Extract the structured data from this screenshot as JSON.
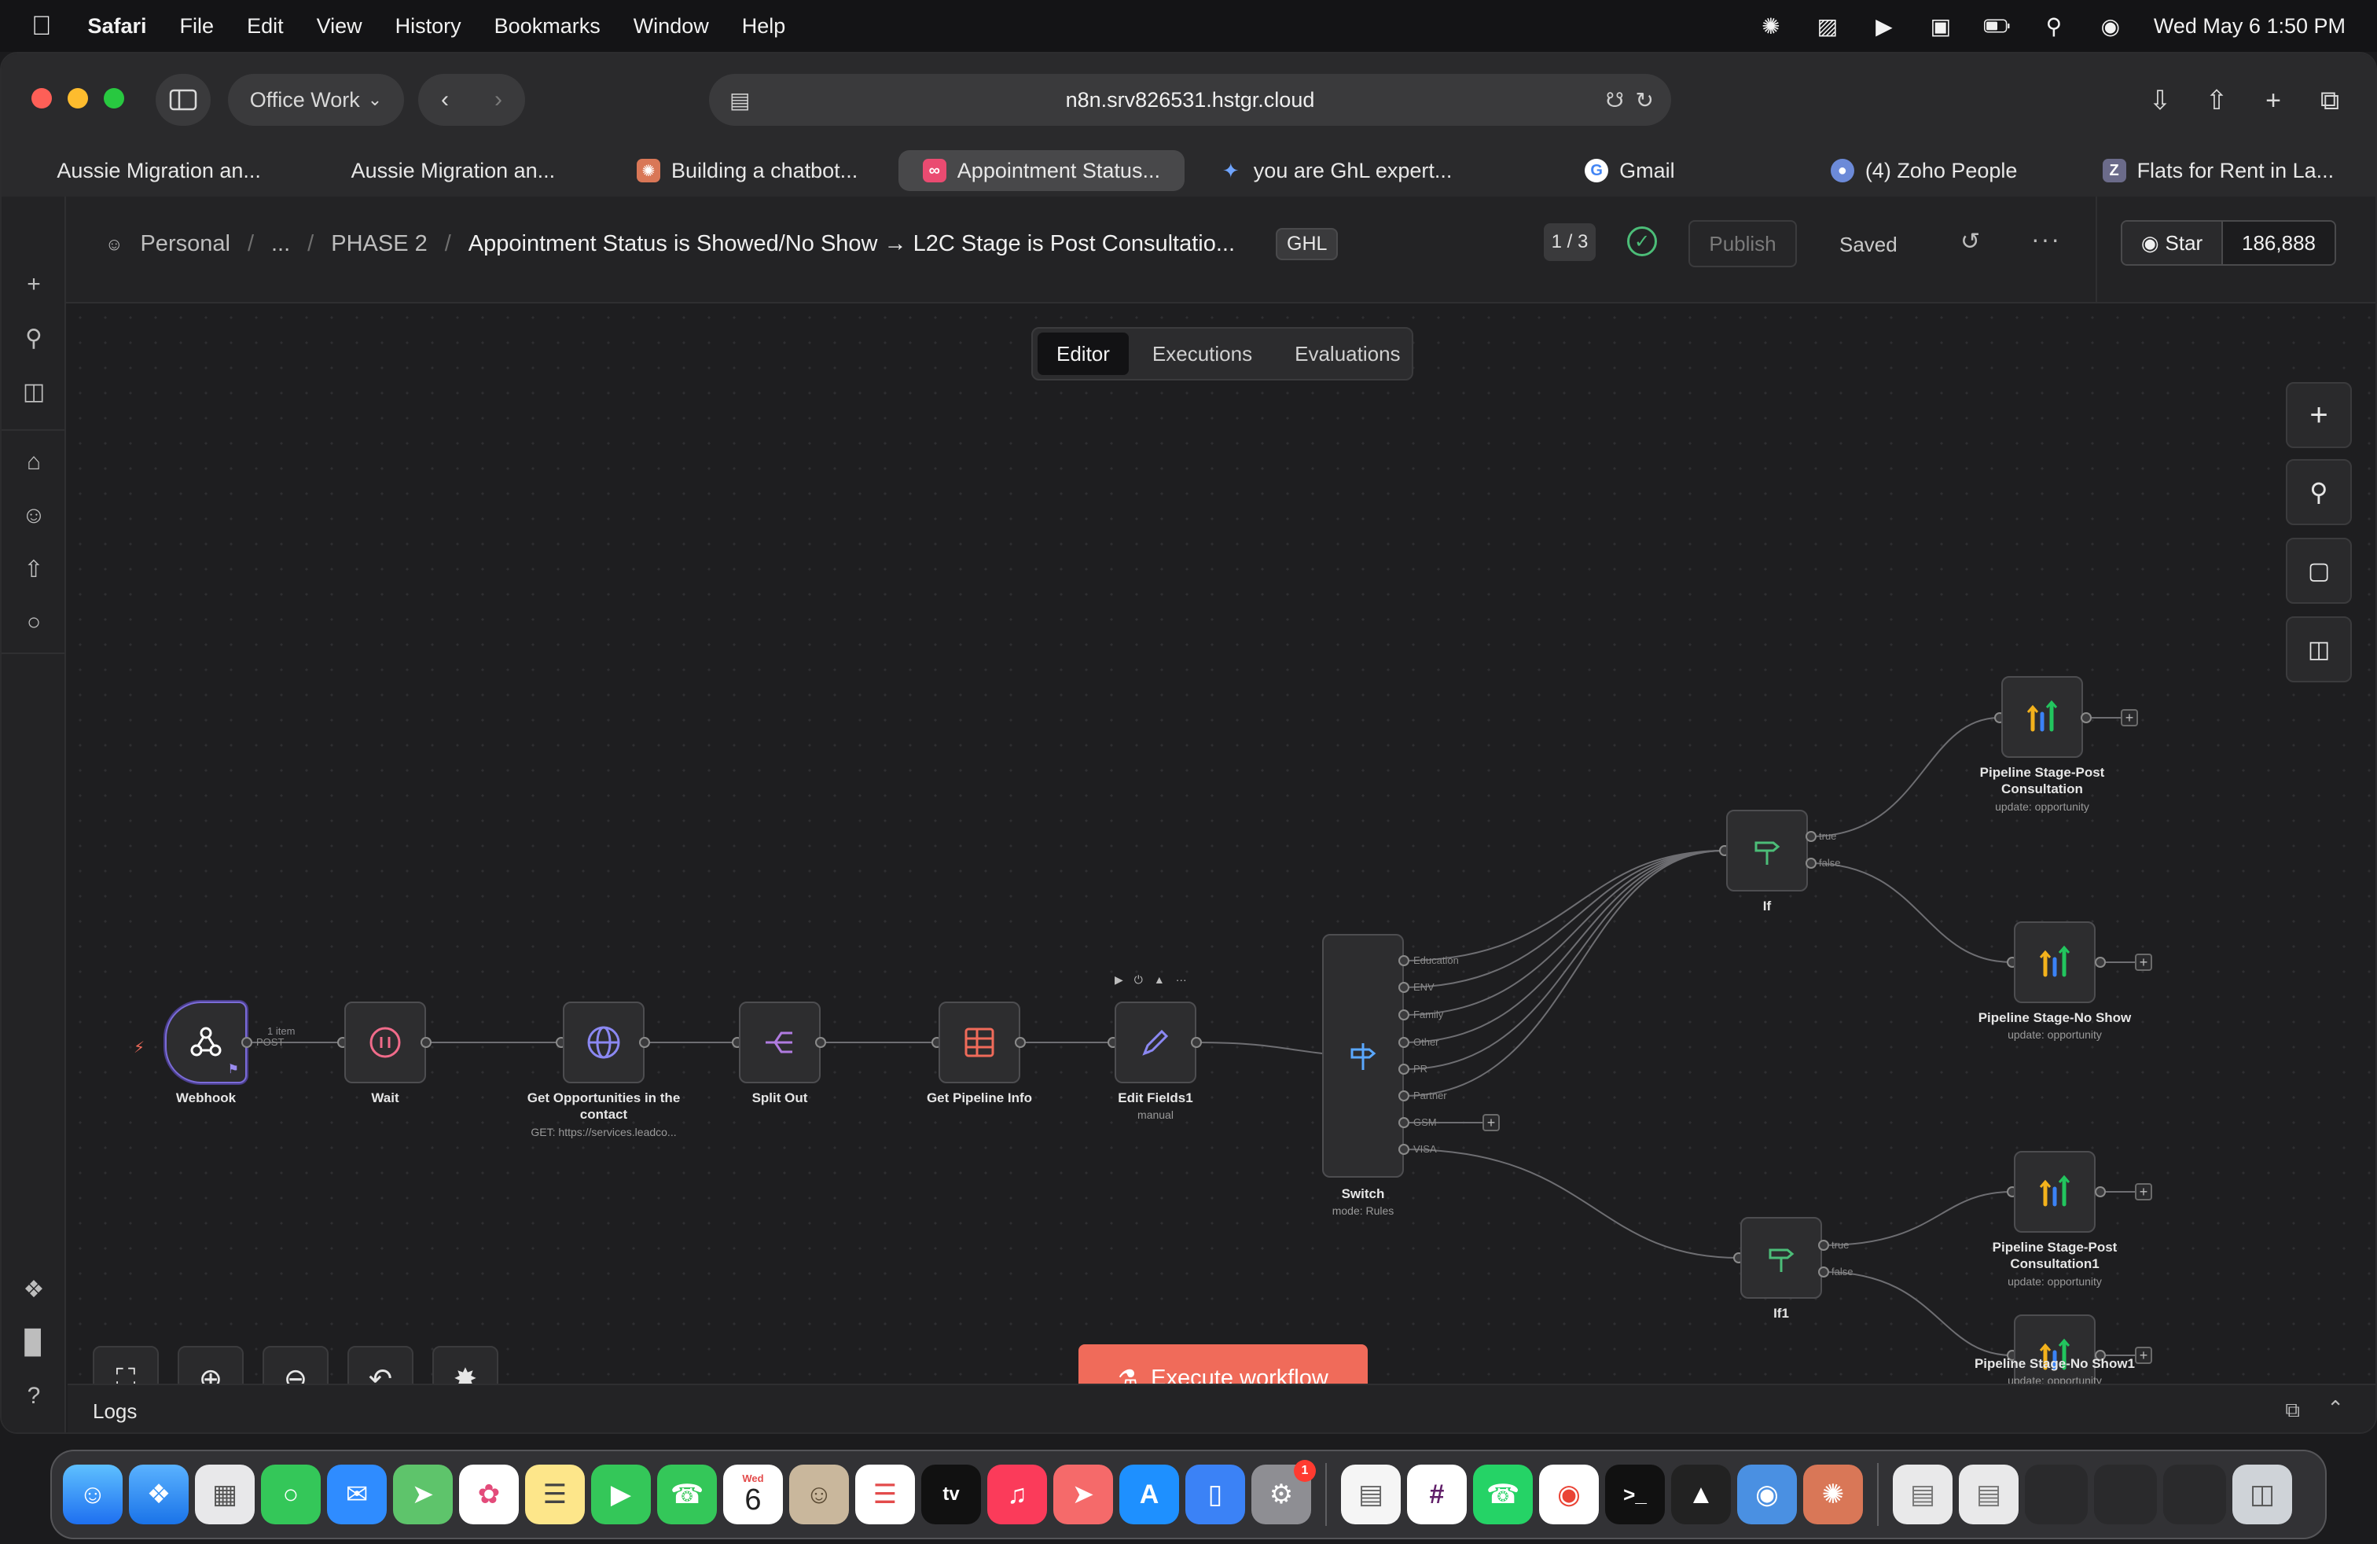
{
  "menubar": {
    "app": "Safari",
    "items": [
      "File",
      "Edit",
      "View",
      "History",
      "Bookmarks",
      "Window",
      "Help"
    ],
    "clock": "Wed May 6  1:50 PM"
  },
  "browser": {
    "profile": "Office Work",
    "url": "n8n.srv826531.hstgr.cloud",
    "tabs": [
      {
        "label": "Aussie Migration an...",
        "active": false
      },
      {
        "label": "Aussie Migration an...",
        "active": false
      },
      {
        "label": "Building a chatbot...",
        "active": false
      },
      {
        "label": "Appointment Status...",
        "active": true
      },
      {
        "label": "you are GhL expert...",
        "active": false
      },
      {
        "label": "Gmail",
        "active": false
      },
      {
        "label": "(4) Zoho People",
        "active": false
      },
      {
        "label": "Flats for Rent in La...",
        "active": false
      }
    ]
  },
  "header": {
    "crumb_personal": "Personal",
    "crumb_ellipsis": "...",
    "crumb_folder": "PHASE 2",
    "workflow_title": "Appointment Status is Showed/No Show → L2C Stage is Post Consultatio...",
    "tag": "GHL",
    "version": "1 / 3",
    "publish": "Publish",
    "saved": "Saved",
    "github_star": "Star",
    "github_count": "186,888"
  },
  "mode_tabs": [
    "Editor",
    "Executions",
    "Evaluations"
  ],
  "nodes": {
    "webhook": {
      "label": "Webhook",
      "port": "POST"
    },
    "wait": {
      "label": "Wait",
      "edge_note": "1 item"
    },
    "get_opps": {
      "label": "Get Opportunities in the contact",
      "sub": "GET: https://services.leadco..."
    },
    "split_out": {
      "label": "Split Out"
    },
    "get_pipeline": {
      "label": "Get Pipeline Info"
    },
    "edit_fields": {
      "label": "Edit Fields1",
      "sub": "manual"
    },
    "switch": {
      "label": "Switch",
      "sub": "mode: Rules",
      "outputs": [
        "Education",
        "ENV",
        "Family",
        "Other",
        "PR",
        "Partner",
        "GSM",
        "VISA"
      ]
    },
    "if": {
      "label": "If",
      "true": "true",
      "false": "false"
    },
    "if1": {
      "label": "If1",
      "true": "true",
      "false": "false"
    },
    "p1": {
      "label": "Pipeline Stage-Post Consultation",
      "sub": "update: opportunity"
    },
    "p2": {
      "label": "Pipeline Stage-No Show",
      "sub": "update: opportunity"
    },
    "p3": {
      "label": "Pipeline Stage-Post Consultation1",
      "sub": "update: opportunity"
    },
    "p4": {
      "label": "Pipeline Stage-No Show1",
      "sub": "update: opportunity"
    }
  },
  "execute": "Execute workflow",
  "logs": "Logs",
  "dock_badge": "1",
  "calendar_day": "6",
  "calendar_month": "Wed"
}
